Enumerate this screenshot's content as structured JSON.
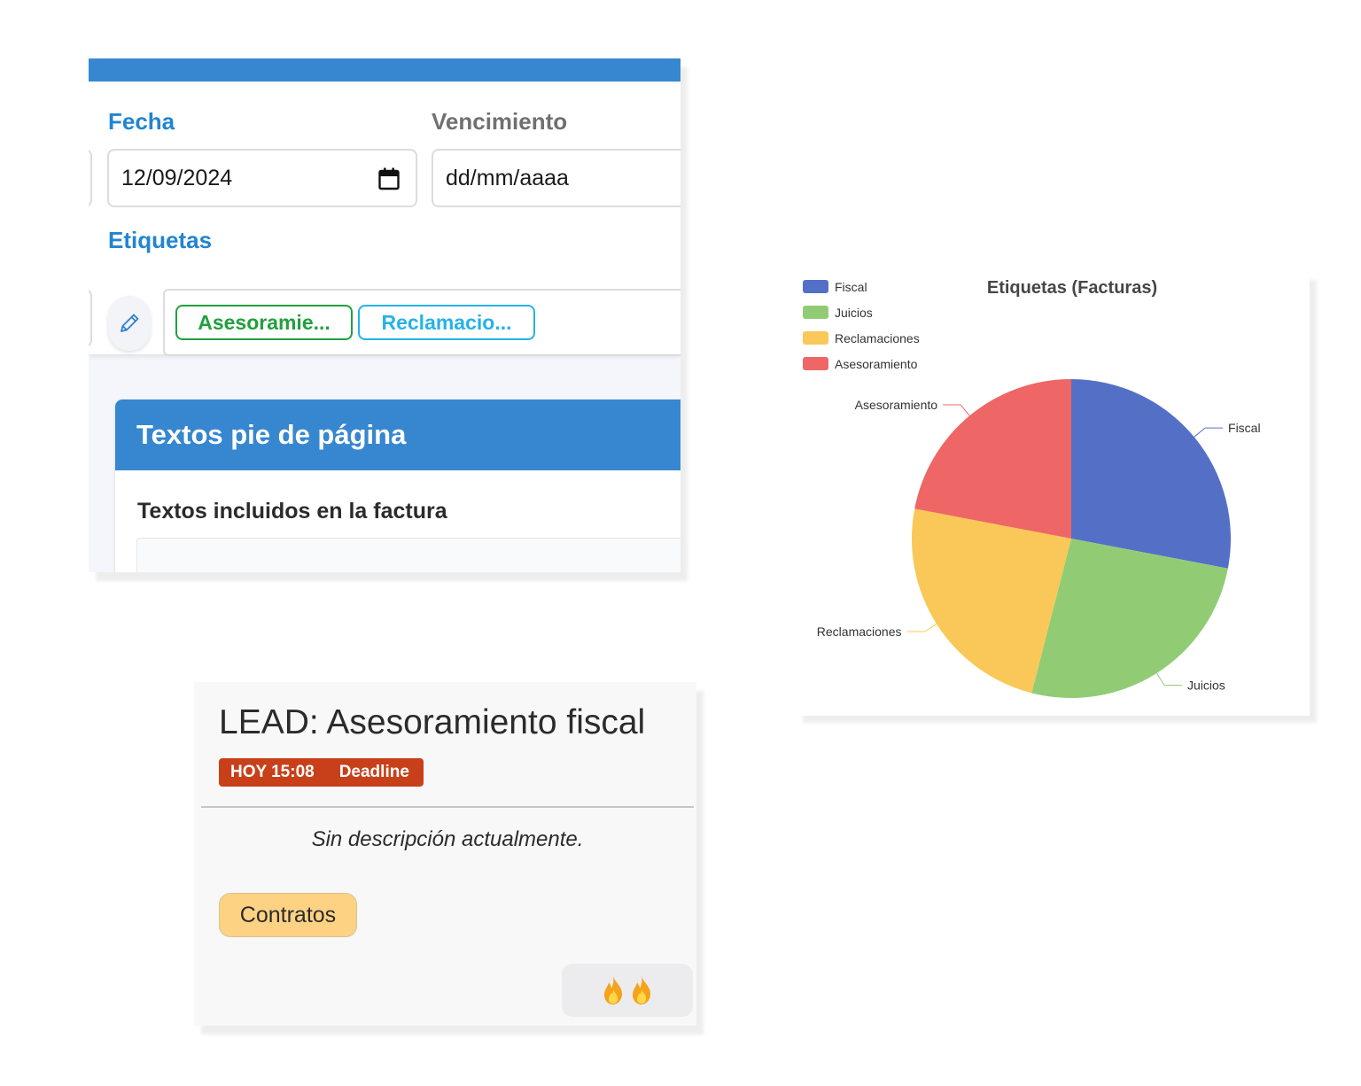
{
  "invoice_form": {
    "fecha_label": "Fecha",
    "fecha_value": "12/09/2024",
    "vencimiento_label": "Vencimiento",
    "vencimiento_placeholder": "dd/mm/aaaa",
    "etiquetas_label": "Etiquetas",
    "tags": [
      "Asesoramie...",
      "Reclamacio..."
    ],
    "icons": {
      "calendar": "calendar-icon",
      "edit": "pencil-icon"
    }
  },
  "footer_panel": {
    "title": "Textos pie de página",
    "subtitle": "Textos incluidos en la factura"
  },
  "lead_card": {
    "title": "LEAD: Asesoramiento fiscal",
    "badge_time": "HOY 15:08",
    "badge_label": "Deadline",
    "description": "Sin descripción actualmente.",
    "tag": "Contratos",
    "priority_icons": [
      "fire-icon",
      "fire-icon"
    ]
  },
  "colors": {
    "accent_blue": "#3787d0",
    "label_blue": "#2185d0",
    "tag_green": "#21a03e",
    "tag_cyan": "#26b2e8",
    "deadline_red": "#c8401a",
    "contract_amber": "#fed283"
  },
  "chart_data": {
    "type": "pie",
    "title": "Etiquetas (Facturas)",
    "legend_position": "top-left",
    "categories": [
      "Fiscal",
      "Juicios",
      "Reclamaciones",
      "Asesoramiento"
    ],
    "values": [
      28,
      26,
      24,
      22
    ],
    "colors": [
      "#5470c6",
      "#91cc75",
      "#fac858",
      "#ee6666"
    ]
  }
}
